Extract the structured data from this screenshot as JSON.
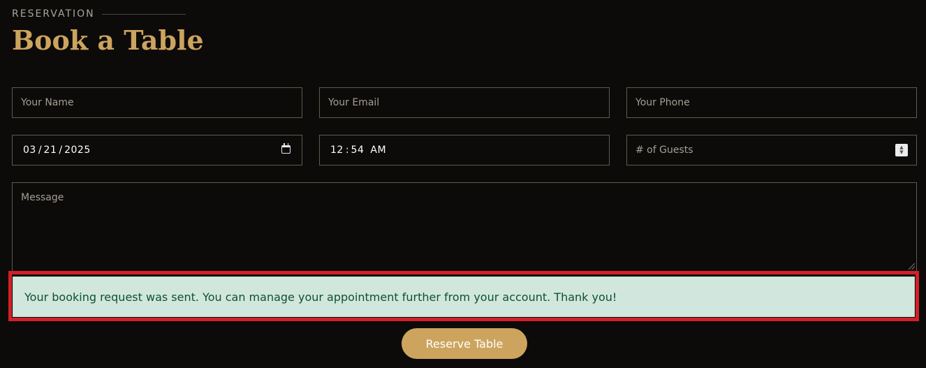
{
  "section": {
    "eyebrow": "RESERVATION",
    "title": "Book a Table"
  },
  "form": {
    "name_placeholder": "Your Name",
    "email_placeholder": "Your Email",
    "phone_placeholder": "Your Phone",
    "date": {
      "month": "03",
      "day": "21",
      "year": "2025",
      "separator": "/"
    },
    "time": {
      "hour": "12",
      "minute": "54",
      "separator": ":",
      "period": "AM"
    },
    "guests_placeholder": "# of Guests",
    "message_placeholder": "Message",
    "submit_label": "Reserve Table"
  },
  "alert": {
    "success_text": "Your booking request was sent. You can manage your appointment further from your account. Thank you!"
  },
  "icons": {
    "date_picker": "calendar-icon",
    "guests_stepper": "spinner-arrows-icon"
  },
  "colors": {
    "background": "#0c0b0a",
    "accent": "#cda45e",
    "success_bg": "#d1e7dd",
    "success_text": "#0f5132",
    "highlight": "#d42027"
  }
}
